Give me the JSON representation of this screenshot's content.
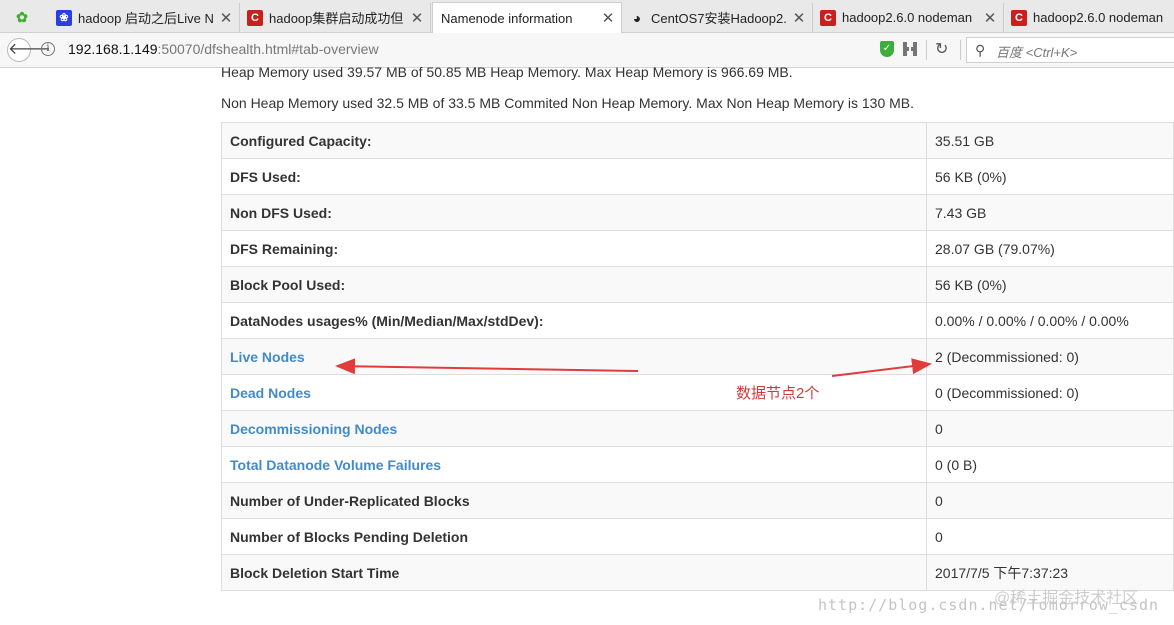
{
  "browser": {
    "tabs": [
      {
        "title": "",
        "favicon": "wechat-icon"
      },
      {
        "title": "hadoop 启动之后Live N",
        "favicon": "baidu-paw-icon"
      },
      {
        "title": "hadoop集群启动成功但",
        "favicon": "csdn-icon"
      },
      {
        "title": "Namenode information",
        "favicon": "",
        "active": true
      },
      {
        "title": "CentOS7安装Hadoop2.",
        "favicon": "linux-penguin-icon"
      },
      {
        "title": "hadoop2.6.0 nodeman",
        "favicon": "csdn-icon"
      },
      {
        "title": "hadoop2.6.0 nodeman",
        "favicon": "csdn-icon"
      }
    ],
    "address": {
      "host": "192.168.1.149",
      "rest": ":50070/dfshealth.html#tab-overview"
    },
    "search": {
      "placeholder": "百度 <Ctrl+K>"
    }
  },
  "memory": {
    "heap": "Heap Memory used 39.57 MB of 50.85 MB Heap Memory. Max Heap Memory is 966.69 MB.",
    "non_heap": "Non Heap Memory used 32.5 MB of 33.5 MB Commited Non Heap Memory. Max Non Heap Memory is 130 MB."
  },
  "summary": {
    "rows": [
      {
        "label": "Configured Capacity:",
        "value": "35.51 GB"
      },
      {
        "label": "DFS Used:",
        "value": "56 KB (0%)"
      },
      {
        "label": "Non DFS Used:",
        "value": "7.43 GB"
      },
      {
        "label": "DFS Remaining:",
        "value": "28.07 GB (79.07%)"
      },
      {
        "label": "Block Pool Used:",
        "value": "56 KB (0%)"
      },
      {
        "label": "DataNodes usages% (Min/Median/Max/stdDev):",
        "value": "0.00% / 0.00% / 0.00% / 0.00%"
      },
      {
        "label": "Live Nodes",
        "value": "2 (Decommissioned: 0)",
        "link": true
      },
      {
        "label": "Dead Nodes",
        "value": "0 (Decommissioned: 0)",
        "link": true
      },
      {
        "label": "Decommissioning Nodes",
        "value": "0",
        "link": true
      },
      {
        "label": "Total Datanode Volume Failures",
        "value": "0 (0 B)",
        "link": true
      },
      {
        "label": "Number of Under-Replicated Blocks",
        "value": "0"
      },
      {
        "label": "Number of Blocks Pending Deletion",
        "value": "0"
      },
      {
        "label": "Block Deletion Start Time",
        "value": "2017/7/5 下午7:37:23"
      }
    ]
  },
  "annotation": {
    "text": "数据节点2个",
    "color": "#e03c3c"
  },
  "watermark": {
    "url": "http://blog.csdn.net/Tomorrow_csdn",
    "brand": "@稀土掘金技术社区"
  },
  "colors": {
    "link": "#428bca",
    "row_stripe": "#f9f9f9",
    "border": "#dddddd"
  }
}
